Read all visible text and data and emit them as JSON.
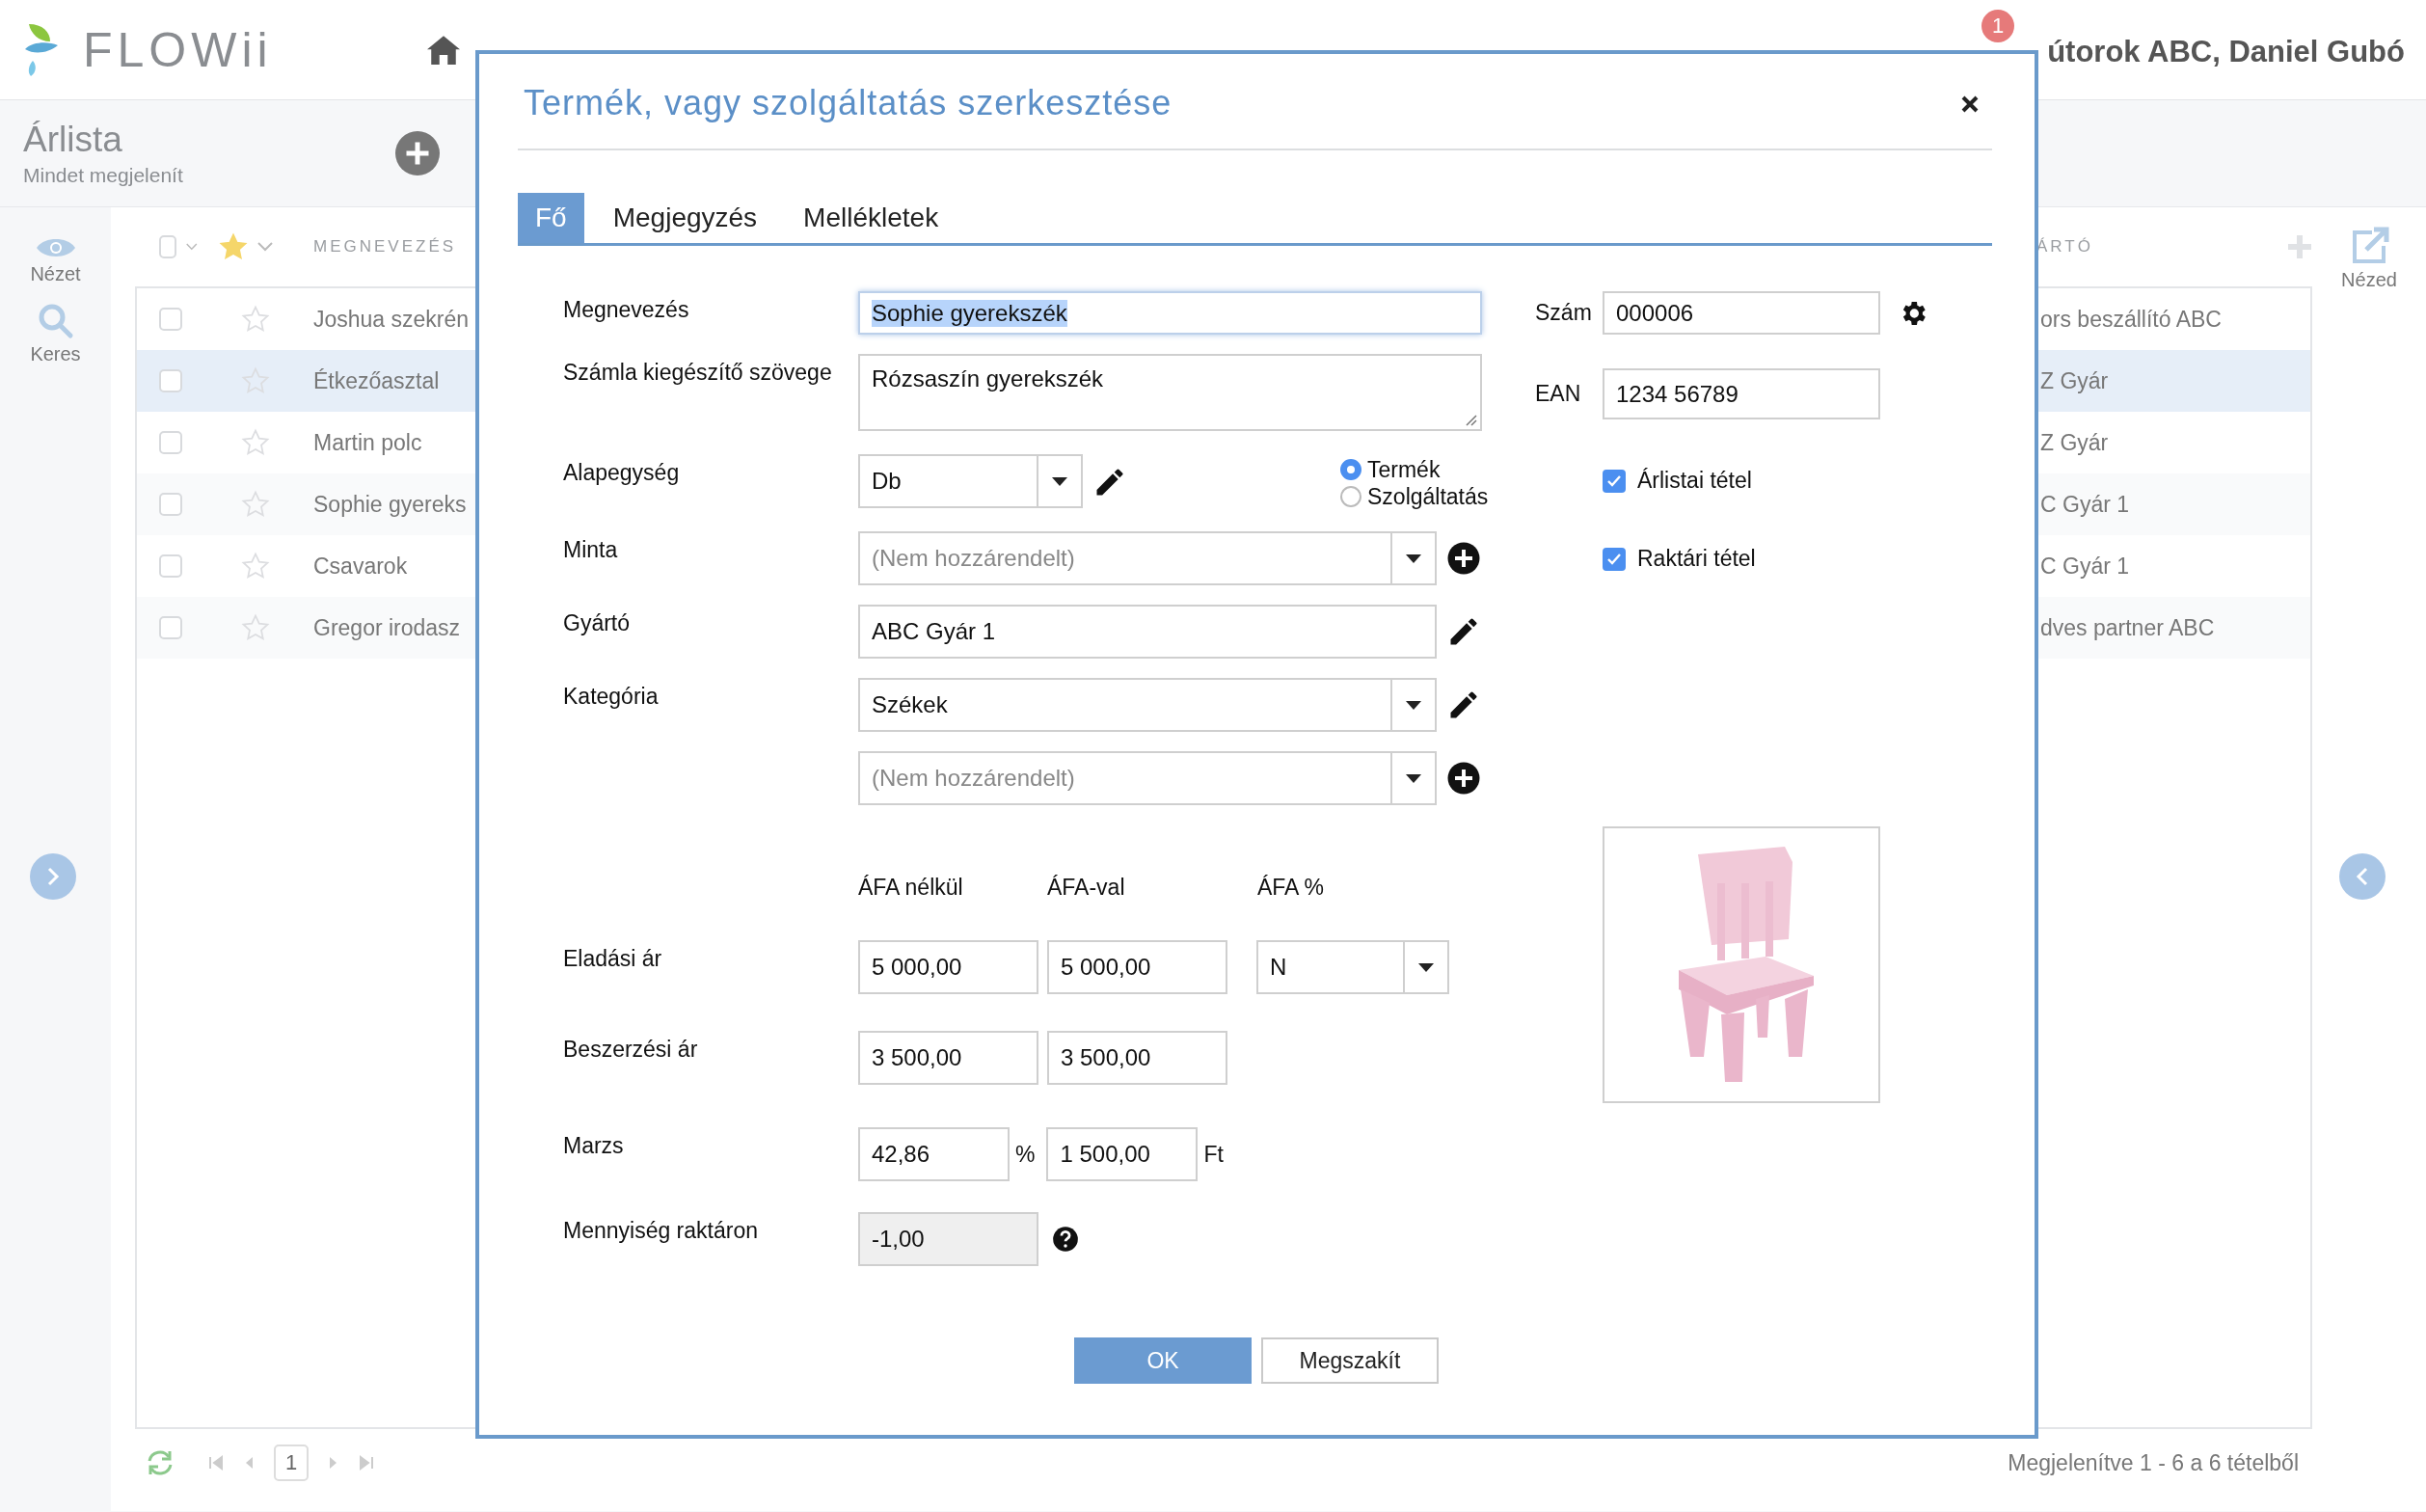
{
  "app": {
    "logo": "FLOWii",
    "notification_count": "1",
    "user": "útorok ABC, Daniel Gubó"
  },
  "page": {
    "title": "Árlista",
    "subtitle": "Mindet megjelenít"
  },
  "sidebar": {
    "items": [
      {
        "kind": "view",
        "label": "Nézet"
      },
      {
        "kind": "search",
        "label": "Keres"
      }
    ]
  },
  "table": {
    "all_selected": false,
    "columns": [
      {
        "label": "MEGNEVEZÉS"
      },
      {
        "label": "ÁRTÓ"
      }
    ],
    "rows": [
      {
        "name": "Joshua szekrén",
        "column_2": "ors beszállító ABC",
        "checked": false,
        "starred": false,
        "selected": false
      },
      {
        "name": "Étkezőasztal",
        "column_2": "Z Gyár",
        "checked": false,
        "starred": false,
        "selected": true
      },
      {
        "name": "Martin polc",
        "column_2": "Z Gyár",
        "checked": false,
        "starred": false,
        "selected": false
      },
      {
        "name": "Sophie gyereks",
        "column_2": "C Gyár 1",
        "checked": false,
        "starred": false,
        "selected": false
      },
      {
        "name": "Csavarok",
        "column_2": "C Gyár 1",
        "checked": false,
        "starred": false,
        "selected": false
      },
      {
        "name": "Gregor irodasz",
        "column_2": "dves partner ABC",
        "checked": false,
        "starred": false,
        "selected": false
      }
    ]
  },
  "right_panel": {
    "label": "Nézed"
  },
  "footer": {
    "page": "1",
    "summary": "Megjelenítve 1 - 6 a 6 tételből"
  },
  "dialog": {
    "title": "Termék, vagy szolgáltatás szerkesztése",
    "tabs": [
      {
        "label": "Fő",
        "selected": true
      },
      {
        "label": "Megjegyzés",
        "selected": false
      },
      {
        "label": "Mellékletek",
        "selected": false
      }
    ],
    "name": {
      "label": "Megnevezés",
      "value": "Sophie gyerekszék",
      "focused": true
    },
    "invoice_text": {
      "label": "Számla kiegészítő szövege",
      "value": "Rózsaszín gyerekszék"
    },
    "base_unit": {
      "label": "Alapegység",
      "value": "Db"
    },
    "type_options": [
      {
        "label": "Termék",
        "selected": true
      },
      {
        "label": "Szolgáltatás",
        "selected": false
      }
    ],
    "sample": {
      "label": "Minta",
      "placeholder": "(Nem hozzárendelt)"
    },
    "manufacturer": {
      "label": "Gyártó",
      "value": "ABC Gyár 1"
    },
    "category": {
      "label": "Kategória",
      "value": "Székek"
    },
    "subcategory": {
      "placeholder": "(Nem hozzárendelt)"
    },
    "price_headings": [
      "ÁFA nélkül",
      "ÁFA-val",
      "ÁFA %"
    ],
    "sale_price": {
      "label": "Eladási ár",
      "net": "5 000,00",
      "gross": "5 000,00",
      "vat": "N"
    },
    "purchase_price": {
      "label": "Beszerzési ár",
      "net": "3 500,00",
      "gross": "3 500,00"
    },
    "margin": {
      "label": "Marzs",
      "percent": "42,86",
      "percent_unit": "%",
      "amount": "1 500,00",
      "amount_unit": "Ft"
    },
    "stock": {
      "label": "Mennyiség raktáron",
      "value": "-1,00",
      "disabled": true
    },
    "number": {
      "label": "Szám",
      "value": "000006"
    },
    "ean": {
      "label": "EAN",
      "value": "1234 56789"
    },
    "flags": [
      {
        "label": "Árlistai tétel",
        "checked": true
      },
      {
        "label": "Raktári tétel",
        "checked": true
      }
    ],
    "buttons": [
      {
        "label": "OK",
        "kind": "primary"
      },
      {
        "label": "Megszakít",
        "kind": "secondary"
      }
    ]
  }
}
